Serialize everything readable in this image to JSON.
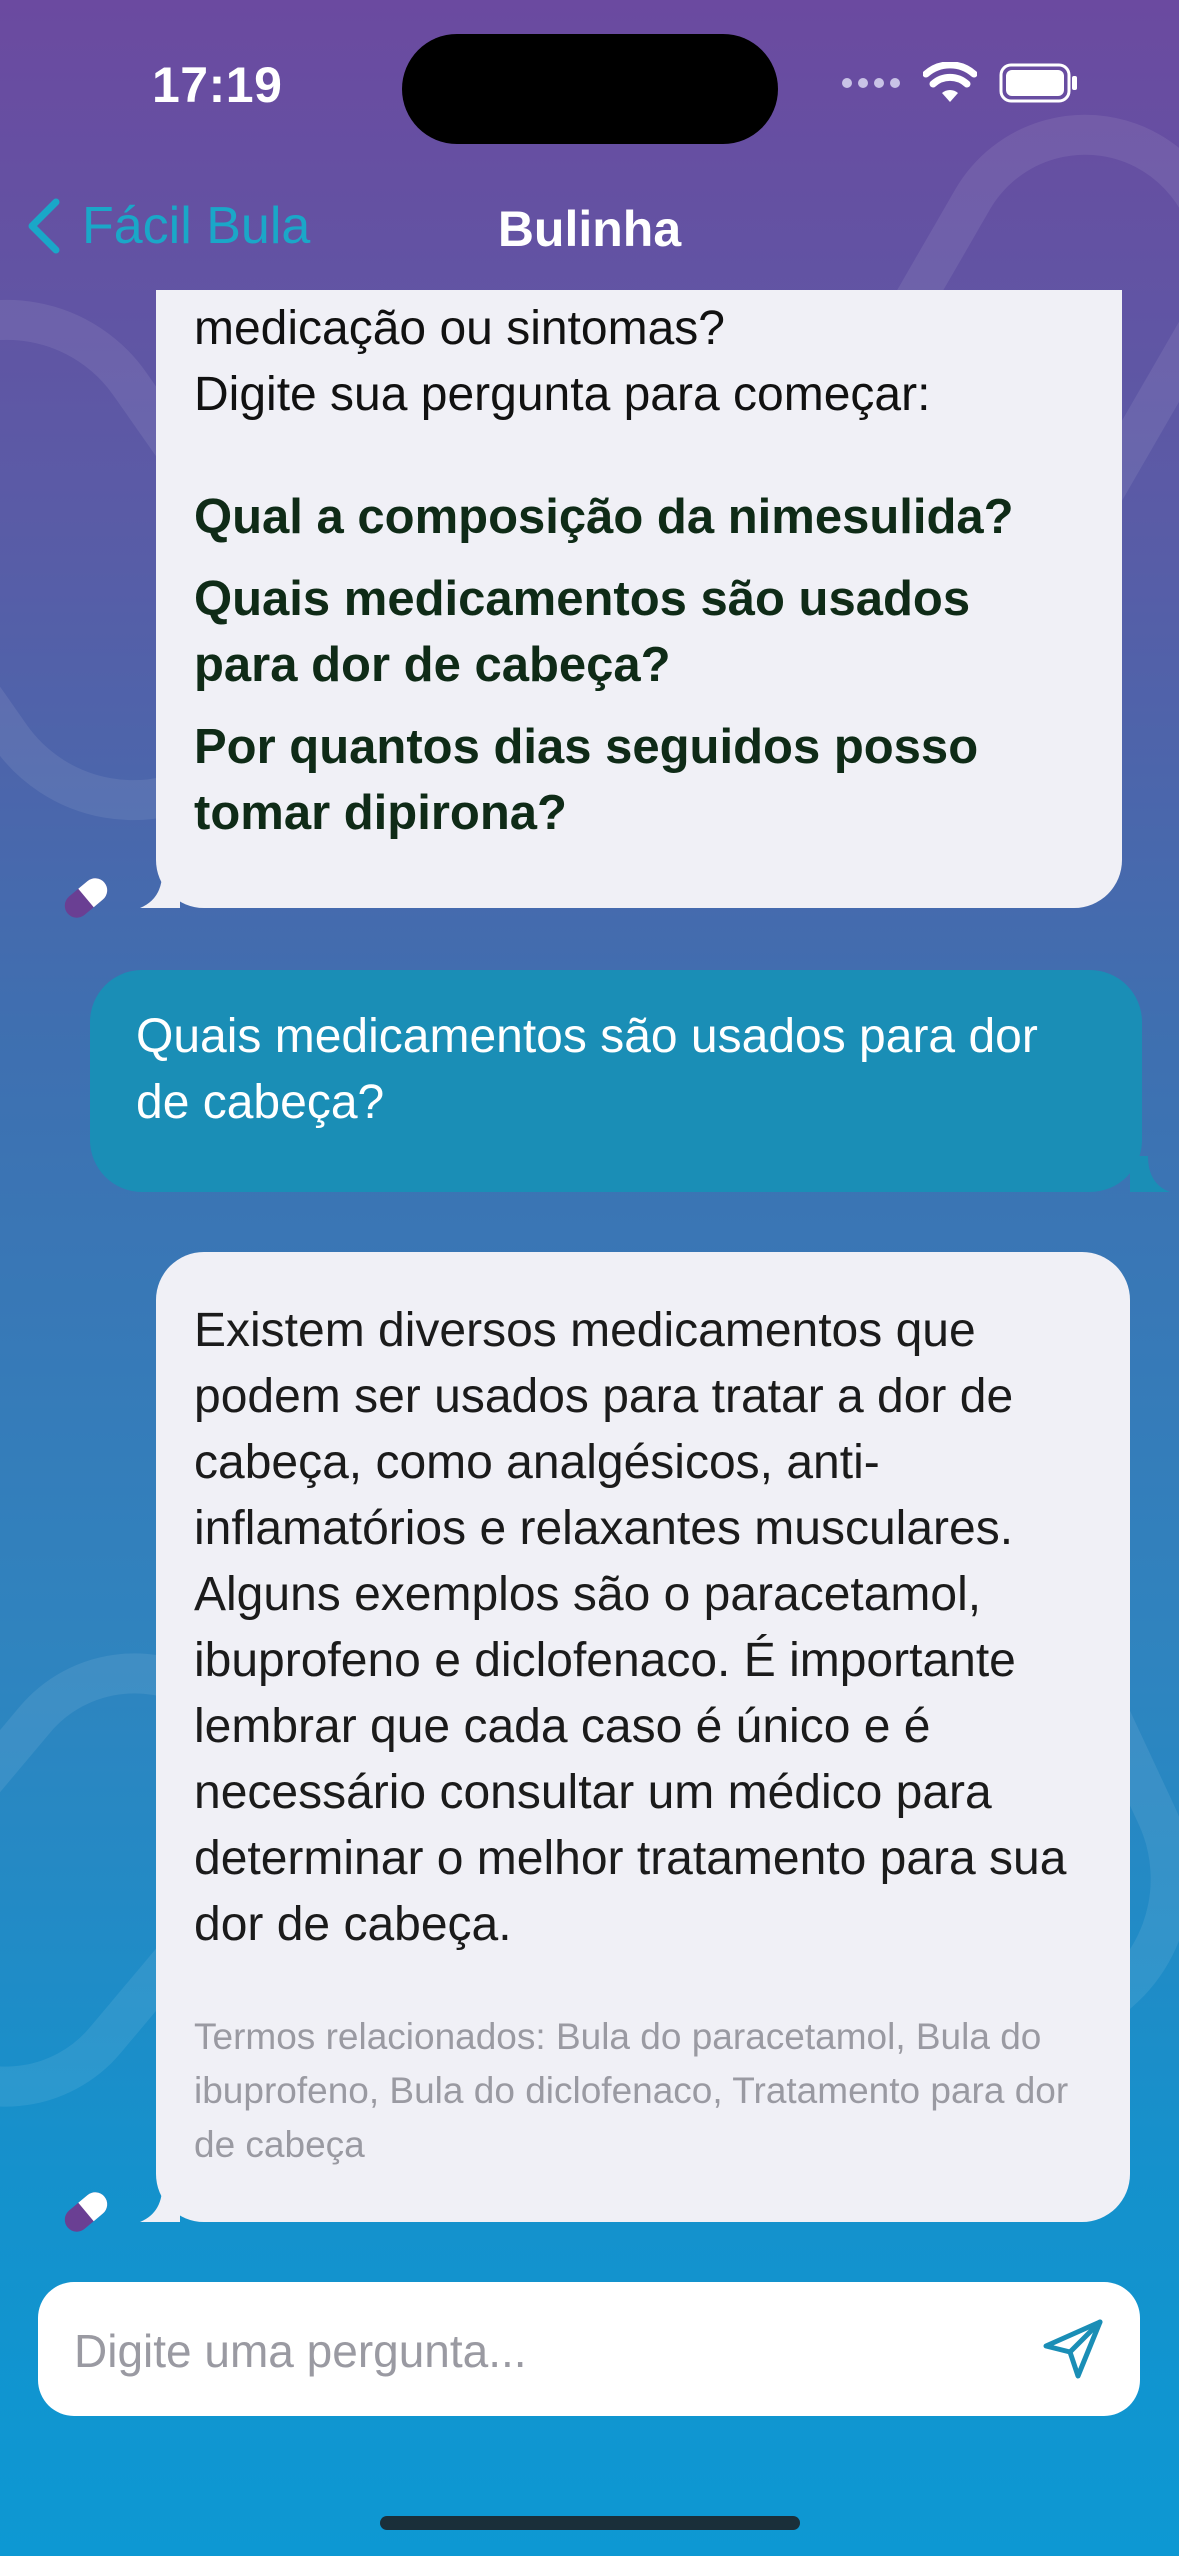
{
  "status_bar": {
    "time": "17:19"
  },
  "nav": {
    "back_label": "Fácil Bula",
    "title": "Bulinha"
  },
  "messages": {
    "bot_intro": {
      "lines": [
        "medicação ou sintomas?",
        "Digite sua pergunta para começar:"
      ],
      "suggestions": [
        "Qual a composição da nimesulida?",
        "Quais medicamentos são usados para dor de cabeça?",
        "Por quantos dias seguidos posso tomar dipirona?"
      ]
    },
    "user_question": "Quais medicamentos são usados para dor de cabeça?",
    "bot_answer": {
      "text": "Existem diversos medicamentos que podem ser usados para tratar a dor de cabeça, como analgésicos, anti-inflamatórios e relaxantes musculares. Alguns exemplos são o paracetamol, ibuprofeno e diclofenaco. É importante lembrar que cada caso é único e é necessário consultar um médico para determinar o melhor tratamento para sua dor de cabeça.",
      "related": "Termos relacionados: Bula do paracetamol, Bula do ibuprofeno, Bula do diclofenaco, Tratamento para dor de cabeça"
    }
  },
  "input": {
    "placeholder": "Digite uma pergunta..."
  },
  "colors": {
    "accent": "#1aa7c8",
    "user_bubble": "#1a8eb6",
    "bot_bubble": "#f0f0f6",
    "suggestion_text": "#0f2b17"
  },
  "icons": {
    "back": "chevron-left-icon",
    "wifi": "wifi-icon",
    "battery": "battery-icon",
    "signal": "signal-icon",
    "avatar": "pill-icon",
    "send": "send-icon"
  }
}
